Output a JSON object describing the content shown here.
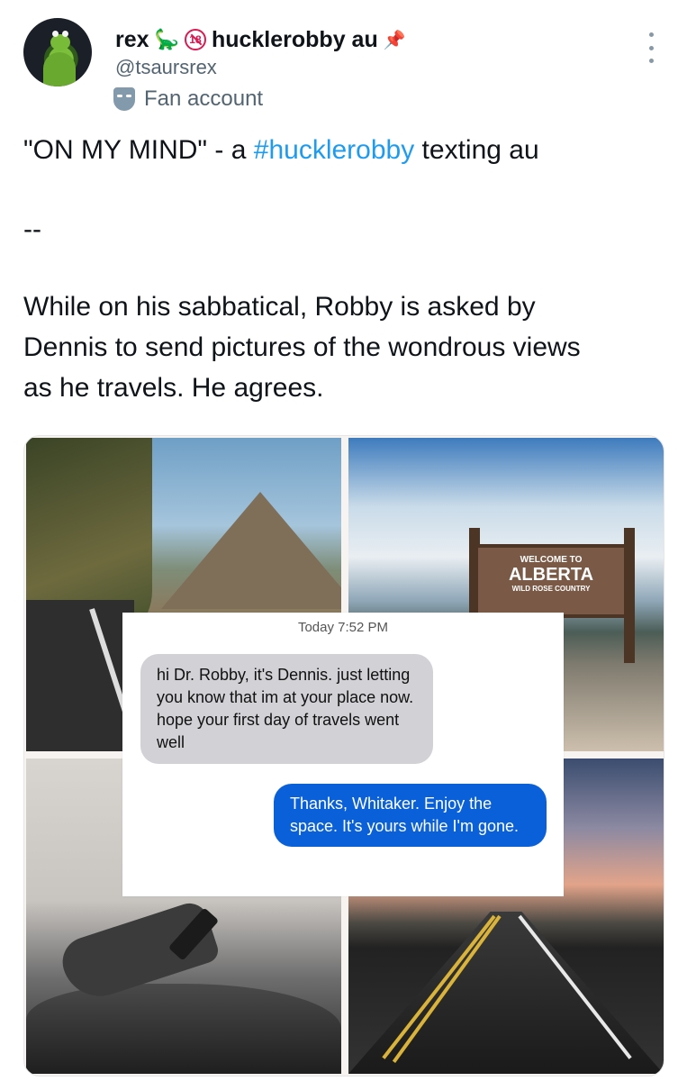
{
  "header": {
    "display_name": "rex",
    "emoji_dino": "🦕",
    "age_badge": "18",
    "display_name_suffix": "hucklerobby au",
    "emoji_pin": "📌",
    "handle": "@tsaursrex",
    "account_label": "Fan account",
    "avatar_icon": "kermit-frog-avatar",
    "more_icon": "vertical-ellipsis-icon"
  },
  "tweet": {
    "title_prefix": "\"ON MY MIND\" - a ",
    "hashtag": "#hucklerobby",
    "title_suffix": " texting au",
    "separator": "--",
    "body_lines": [
      "While on his sabbatical, Robby is asked by",
      "Dennis to send pictures of the wondrous views",
      "as he travels. He agrees."
    ]
  },
  "media": {
    "sign": {
      "line1": "WELCOME TO",
      "line2": "ALBERTA",
      "line3": "WILD ROSE COUNTRY"
    },
    "messages": {
      "timestamp": "Today 7:52 PM",
      "incoming": "hi Dr. Robby, it's Dennis. just letting you know that im at your place now. hope your first day of travels went well",
      "outgoing": "Thanks, Whitaker. Enjoy the space. It's yours while I'm gone."
    }
  },
  "colors": {
    "hashtag": "#1d9bf0",
    "incoming_bubble": "#d1d1d6",
    "outgoing_bubble": "#0a60d8",
    "secondary_text": "#536471"
  }
}
